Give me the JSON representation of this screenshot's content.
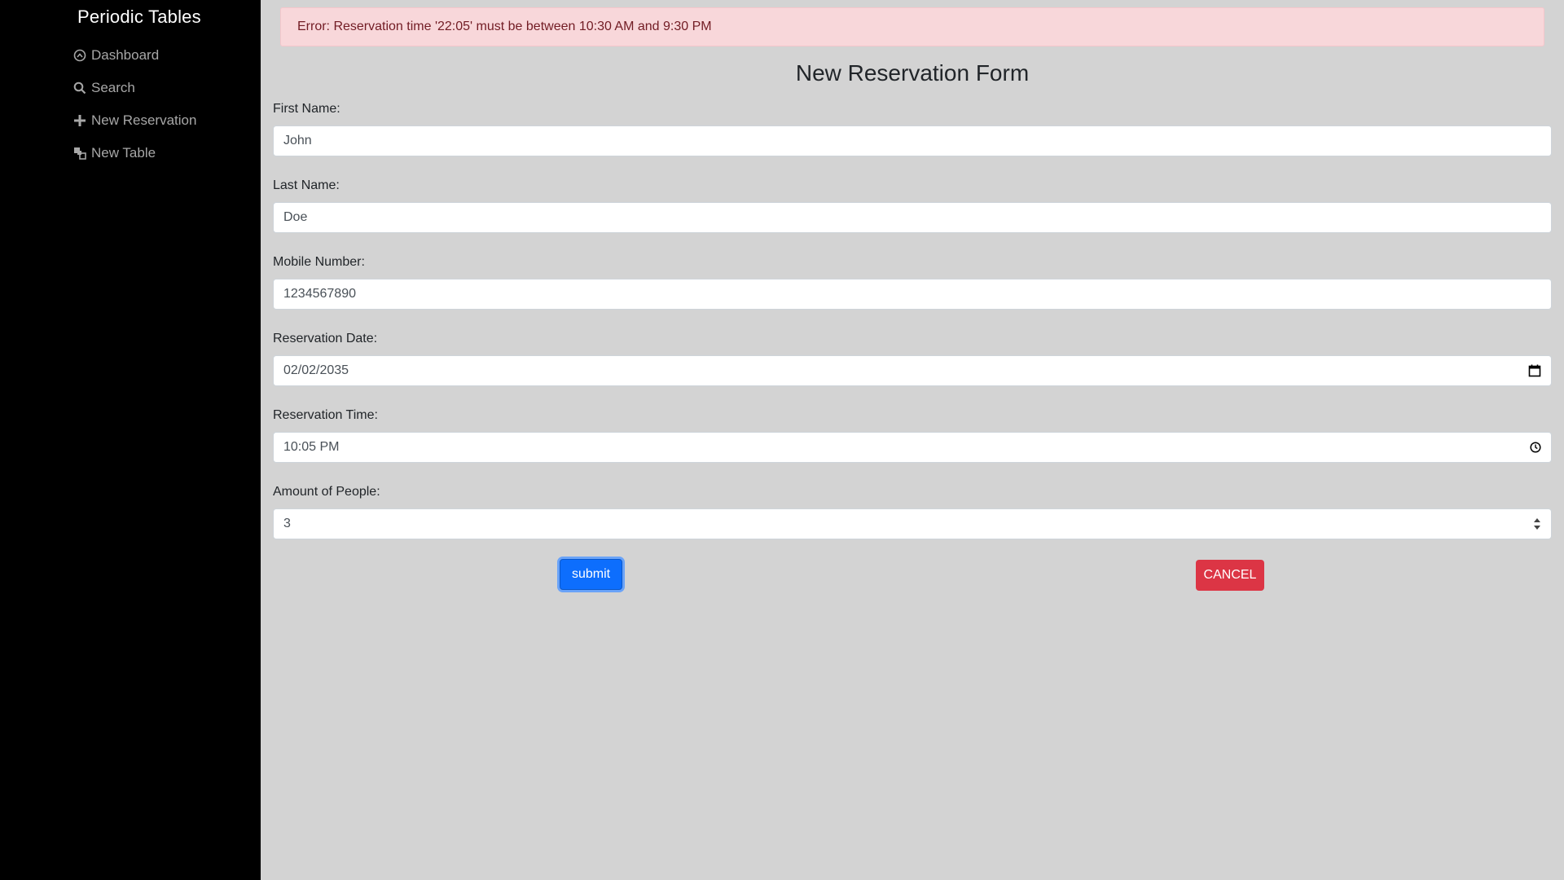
{
  "sidebar": {
    "brand": "Periodic Tables",
    "items": [
      {
        "label": "Dashboard",
        "icon": "dashboard-icon"
      },
      {
        "label": "Search",
        "icon": "search-icon"
      },
      {
        "label": "New Reservation",
        "icon": "plus-icon"
      },
      {
        "label": "New Table",
        "icon": "table-icon"
      }
    ]
  },
  "alert": {
    "message": "Error: Reservation time '22:05' must be between 10:30 AM and 9:30 PM"
  },
  "form": {
    "title": "New Reservation Form",
    "first_name": {
      "label": "First Name:",
      "value": "John"
    },
    "last_name": {
      "label": "Last Name:",
      "value": "Doe"
    },
    "mobile": {
      "label": "Mobile Number:",
      "value": "1234567890"
    },
    "date": {
      "label": "Reservation Date:",
      "value": "02/02/2035"
    },
    "time": {
      "label": "Reservation Time:",
      "value": "10:05 PM"
    },
    "people": {
      "label": "Amount of People:",
      "value": "3"
    },
    "submit_label": "submit",
    "cancel_label": "CANCEL"
  },
  "colors": {
    "sidebar_bg": "#000000",
    "main_bg": "#d3d3d3",
    "alert_bg": "#f8d7da",
    "submit": "#0d6efd",
    "cancel": "#dc3545"
  }
}
